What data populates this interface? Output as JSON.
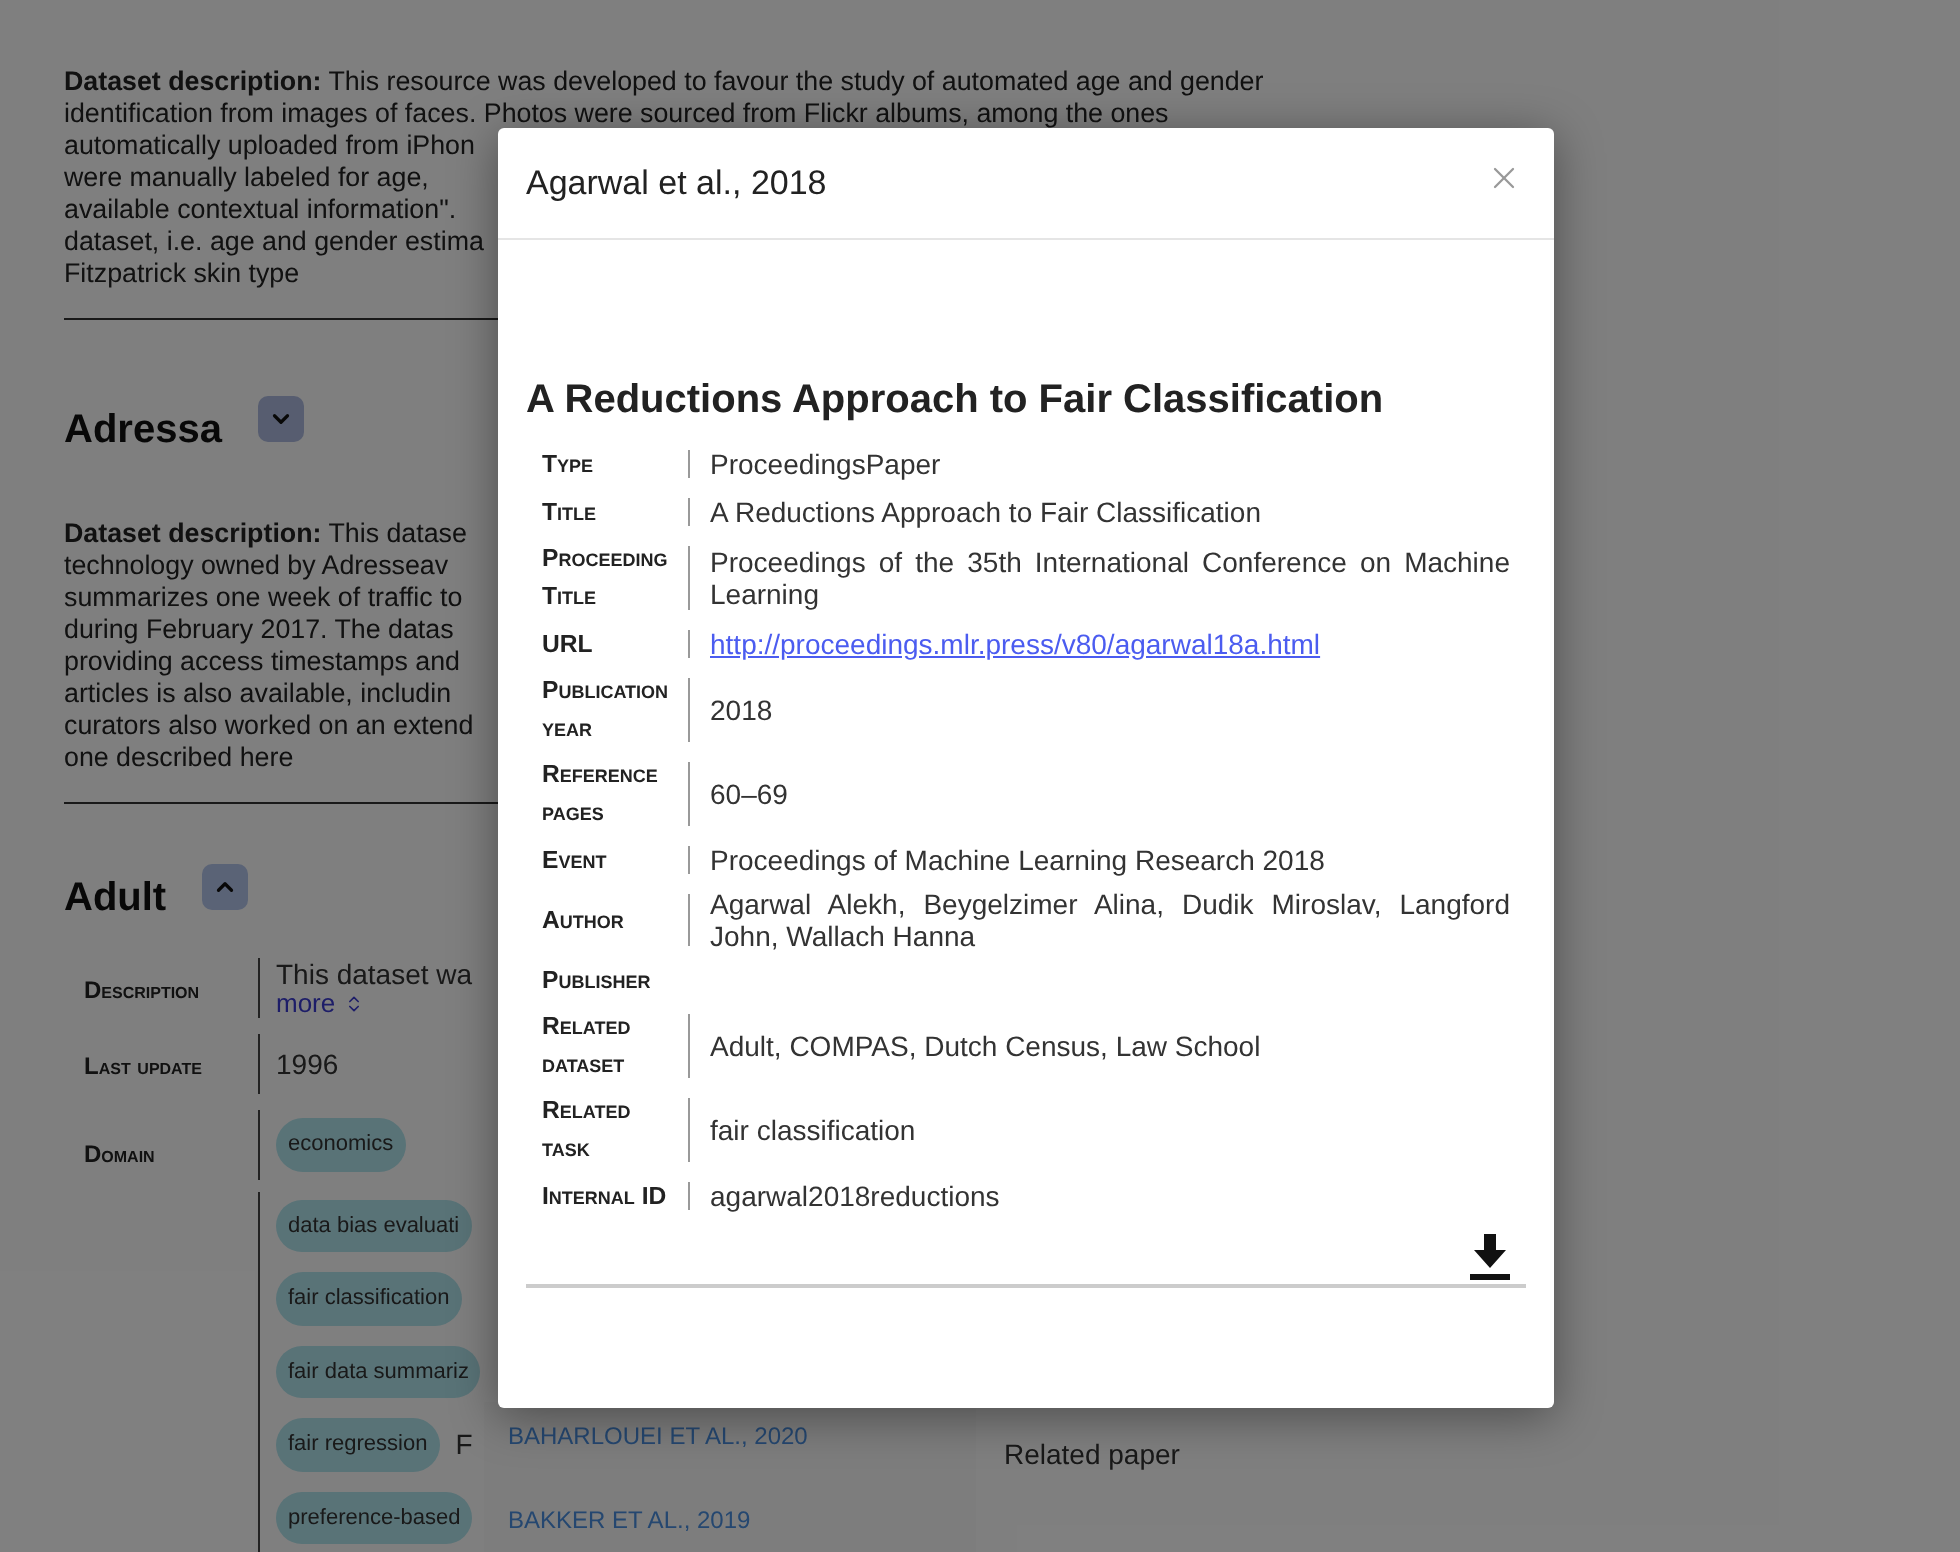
{
  "background": {
    "intro_lines": [
      "**Dataset description:** This resource was developed to favour the study of automated age and gender",
      "identification from images of faces. Photos were sourced from Flickr albums, among the ones",
      "automatically uploaded from iPhon",
      "were manually labeled for age,",
      "available contextual information\".",
      "dataset, i.e. age and gender estima",
      "Fitzpatrick skin type"
    ],
    "sections": [
      {
        "title": "Adressa",
        "expanded": false,
        "description_lines": [
          "**Dataset description:** This datase",
          "technology owned by Adresseav",
          "summarizes one week of traffic to",
          "during February 2017. The datas",
          "providing access timestamps and",
          "articles is also available, includin",
          "curators also worked on an extend",
          "one described here"
        ]
      },
      {
        "title": "Adult",
        "expanded": true,
        "fields": [
          {
            "kind": "text",
            "label": "Description",
            "value": "This dataset wa",
            "link": "more"
          },
          {
            "kind": "text",
            "label": "Last update",
            "value": "1996"
          },
          {
            "kind": "chips",
            "label": "Domain",
            "chips": [
              "economics"
            ]
          },
          {
            "kind": "chips",
            "chips": [
              "data bias evaluati",
              "fair classification",
              "fair data summariz",
              "fair regression",
              "preference-based"
            ],
            "chip_note": "F"
          }
        ],
        "related_papers": [
          "BAHARLOUEI ET AL., 2020",
          "BAKKER ET AL., 2019"
        ],
        "related_label": "Related paper"
      }
    ]
  },
  "modal": {
    "title": "Agarwal et al., 2018",
    "heading": "A Reductions Approach to Fair Classification",
    "rows": [
      {
        "kind": "text",
        "label": "Type",
        "value": "ProceedingsPaper"
      },
      {
        "kind": "text",
        "label": "Title",
        "value": "A Reductions Approach to Fair Classification"
      },
      {
        "kind": "text",
        "label": "Proceeding Title",
        "value": "Proceedings of the 35th International Conference on Machine Learning"
      },
      {
        "kind": "link",
        "label": "URL",
        "value": "http://proceedings.mlr.press/v80/agarwal18a.html"
      },
      {
        "kind": "text",
        "label": "Publication year",
        "value": "2018"
      },
      {
        "kind": "text",
        "label": "Reference pages",
        "value": "60–69"
      },
      {
        "kind": "text",
        "label": "Event",
        "value": "Proceedings of Machine Learning Research 2018"
      },
      {
        "kind": "text",
        "label": "Author",
        "value": "Agarwal Alekh, Beygelzimer Alina, Dudik Miroslav, Langford John, Wallach Hanna"
      },
      {
        "kind": "empty",
        "label": "Publisher"
      },
      {
        "kind": "text",
        "label": "Related dataset",
        "value": "Adult, COMPAS, Dutch Census, Law School"
      },
      {
        "kind": "text",
        "label": "Related task",
        "value": "fair classification"
      },
      {
        "kind": "text",
        "label": "Internal ID",
        "value": "agarwal2018reductions"
      }
    ]
  }
}
